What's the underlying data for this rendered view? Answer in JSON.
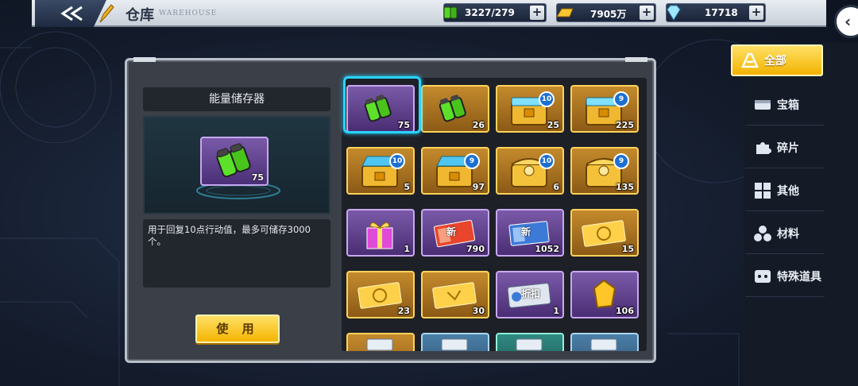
{
  "header": {
    "title": "仓库",
    "subtitle": "WAREHOUSE"
  },
  "resources": [
    {
      "name": "energy",
      "value": "3227/279",
      "icon": "energy-battery-icon"
    },
    {
      "name": "gold",
      "value": "7905万",
      "icon": "gold-bar-icon"
    },
    {
      "name": "diamond",
      "value": "17718",
      "icon": "diamond-icon"
    }
  ],
  "selected_item": {
    "name": "能量储存器",
    "quantity": "75",
    "description": "用于回复10点行动值，最多可储存3000个。",
    "use_label": "使 用"
  },
  "inventory": [
    {
      "qty": "75",
      "rarity": "purple",
      "art": "battery"
    },
    {
      "qty": "26",
      "rarity": "gold",
      "art": "battery"
    },
    {
      "qty": "25",
      "rarity": "gold",
      "art": "chest-blue",
      "level": "10"
    },
    {
      "qty": "225",
      "rarity": "gold",
      "art": "chest-blue",
      "level": "9"
    },
    {
      "qty": "5",
      "rarity": "gold",
      "art": "chest-open",
      "level": "10"
    },
    {
      "qty": "97",
      "rarity": "gold",
      "art": "chest-open",
      "level": "9"
    },
    {
      "qty": "6",
      "rarity": "gold",
      "art": "chest-gold",
      "level": "10"
    },
    {
      "qty": "135",
      "rarity": "gold",
      "art": "chest-gold",
      "level": "9"
    },
    {
      "qty": "1",
      "rarity": "purple",
      "art": "gift"
    },
    {
      "qty": "790",
      "rarity": "purple",
      "art": "ticket-red",
      "label": "新"
    },
    {
      "qty": "1052",
      "rarity": "purple",
      "art": "ticket-blue",
      "label": "新"
    },
    {
      "qty": "15",
      "rarity": "gold",
      "art": "ticket-gold"
    },
    {
      "qty": "23",
      "rarity": "gold",
      "art": "ticket-gold"
    },
    {
      "qty": "30",
      "rarity": "gold",
      "art": "ticket-gold-2"
    },
    {
      "qty": "1",
      "rarity": "purple",
      "art": "discount",
      "label": "折扣"
    },
    {
      "qty": "106",
      "rarity": "purple",
      "art": "gem-gold"
    },
    {
      "qty": "",
      "rarity": "gold",
      "art": "partial"
    },
    {
      "qty": "",
      "rarity": "blue",
      "art": "partial"
    },
    {
      "qty": "",
      "rarity": "teal",
      "art": "partial"
    },
    {
      "qty": "",
      "rarity": "blue",
      "art": "partial"
    }
  ],
  "side_nav": [
    {
      "label": "全部",
      "icon": "all-icon",
      "active": true
    },
    {
      "label": "宝箱",
      "icon": "chest-icon",
      "active": false
    },
    {
      "label": "碎片",
      "icon": "puzzle-icon",
      "active": false
    },
    {
      "label": "其他",
      "icon": "grid-icon",
      "active": false
    },
    {
      "label": "材料",
      "icon": "material-icon",
      "active": false
    },
    {
      "label": "特殊道具",
      "icon": "special-icon",
      "active": false
    }
  ],
  "colors": {
    "accent_gold": "#f4b400",
    "select_cyan": "#29d3ff",
    "panel": "#3a3f48"
  }
}
